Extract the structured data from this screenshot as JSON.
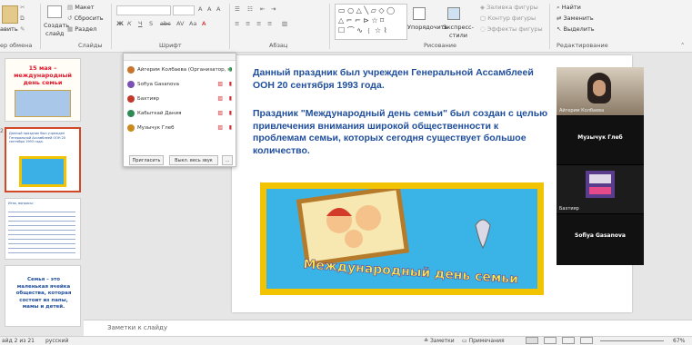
{
  "ribbon": {
    "clipboard": {
      "paste": "авить",
      "label": "ер обмена"
    },
    "slides": {
      "create": "Создать",
      "slide": "слайд",
      "layout": "Макет",
      "reset": "Сбросить",
      "section": "Раздел",
      "label": "Слайды"
    },
    "font": {
      "label": "Шрифт"
    },
    "paragraph": {
      "label": "Абзац"
    },
    "drawing": {
      "arrange": "Упорядочить",
      "styles": "Экспресс-стили",
      "fill": "Заливка фигуры",
      "outline": "Контур фигуры",
      "effects": "Эффекты фигуры",
      "label": "Рисование"
    },
    "editing": {
      "find": "Найти",
      "replace": "Заменить",
      "select": "Выделить",
      "label": "Редактирование"
    }
  },
  "thumbnails": [
    {
      "num": "",
      "title": "15 мая – международный день семьи"
    },
    {
      "num": "2",
      "text": "Данный праздник был учрежден Генеральной Ассамблеей ООН 20 сентября 1993 года."
    },
    {
      "num": "",
      "text": "Итак, вопросы:"
    },
    {
      "num": "",
      "text": "Семья – это маленькая ячейка общества, которая состоит из папы, мамы и детей."
    }
  ],
  "participants": {
    "list": [
      {
        "name": "Айгерим Колбаева (Организатор, я)",
        "color": "#c9742c"
      },
      {
        "name": "Sofiya Gasanova",
        "color": "#7b4fb5"
      },
      {
        "name": "Бахтияр",
        "color": "#c0392b"
      },
      {
        "name": "Кабыткай Дания",
        "color": "#2e8b57"
      },
      {
        "name": "Музычук Глеб",
        "color": "#c98a1e"
      }
    ],
    "invite": "Пригласить",
    "mute_all": "Выкл. весь звук",
    "more": "..."
  },
  "slide": {
    "p1": "Данный праздник был учрежден Генеральной Ассамблеей ООН  20 сентября 1993 года.",
    "p2": "Праздник \"Международный день семьи\" был создан с целью привлечения внимания широкой общественности к проблемам семьи, которых сегодня существует большое количество.",
    "image_caption": "Международный день семьи"
  },
  "video": {
    "tiles": [
      {
        "label": "Айгерим Колбаева",
        "name": ""
      },
      {
        "label": "",
        "name": "Музычук Глеб"
      },
      {
        "label": "Бахтияр",
        "name": ""
      },
      {
        "label": "",
        "name": "Sofiya Gasanova"
      }
    ]
  },
  "notes": {
    "placeholder": "Заметки к слайду"
  },
  "status": {
    "slide": "айд 2 из 21",
    "lang": "русский",
    "notes": "Заметки",
    "comments": "Примечания",
    "zoom": "67%"
  }
}
